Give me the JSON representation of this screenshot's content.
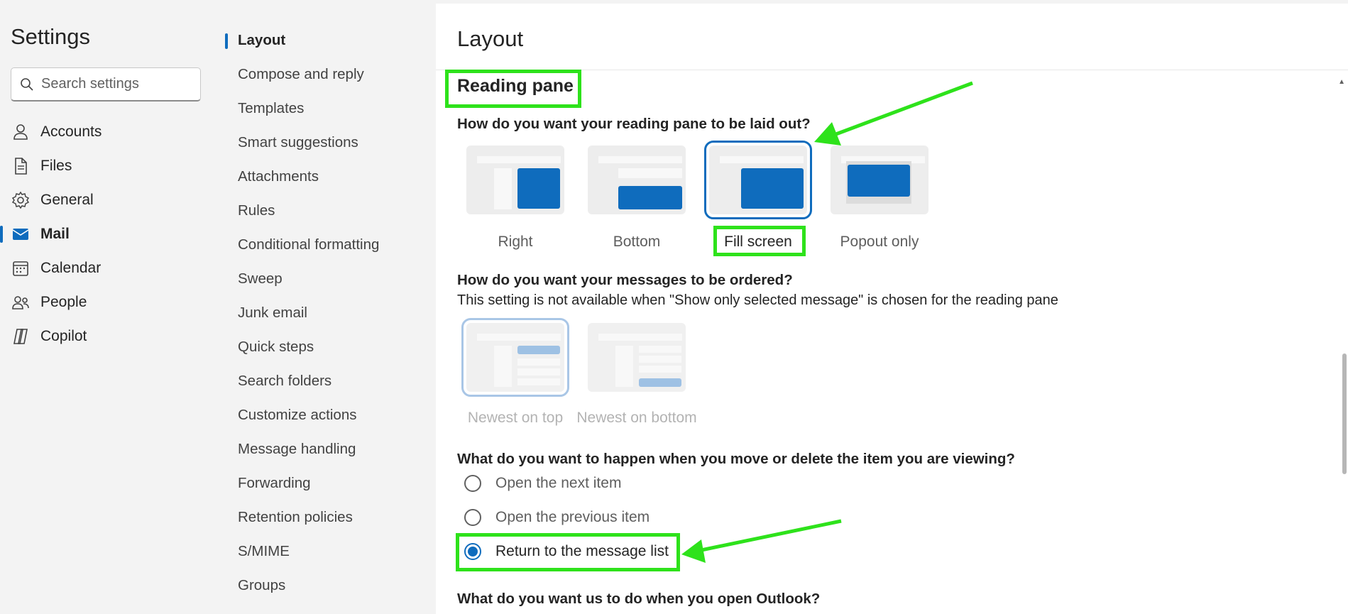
{
  "sidebar": {
    "title": "Settings",
    "search_placeholder": "Search settings",
    "items": [
      {
        "label": "Accounts",
        "icon": "person-icon"
      },
      {
        "label": "Files",
        "icon": "file-icon"
      },
      {
        "label": "General",
        "icon": "gear-icon"
      },
      {
        "label": "Mail",
        "icon": "mail-icon",
        "active": true
      },
      {
        "label": "Calendar",
        "icon": "calendar-icon"
      },
      {
        "label": "People",
        "icon": "people-icon"
      },
      {
        "label": "Copilot",
        "icon": "copilot-icon"
      }
    ]
  },
  "subnav": {
    "items": [
      "Layout",
      "Compose and reply",
      "Templates",
      "Smart suggestions",
      "Attachments",
      "Rules",
      "Conditional formatting",
      "Sweep",
      "Junk email",
      "Quick steps",
      "Search folders",
      "Customize actions",
      "Message handling",
      "Forwarding",
      "Retention policies",
      "S/MIME",
      "Groups"
    ],
    "active": "Layout"
  },
  "main": {
    "title": "Layout",
    "section_title": "Reading pane",
    "q1": "How do you want your reading pane to be laid out?",
    "pane_options": [
      "Right",
      "Bottom",
      "Fill screen",
      "Popout only"
    ],
    "pane_selected": "Fill screen",
    "q2": "How do you want your messages to be ordered?",
    "q2_note": "This setting is not available when \"Show only selected message\" is chosen for the reading pane",
    "order_options": [
      "Newest on top",
      "Newest on bottom"
    ],
    "q3": "What do you want to happen when you move or delete the item you are viewing?",
    "radio_options": [
      "Open the next item",
      "Open the previous item",
      "Return to the message list"
    ],
    "radio_selected": "Return to the message list",
    "q4": "What do you want us to do when you open Outlook?"
  },
  "colors": {
    "accent": "#0f6cbd",
    "annotation": "#2ee21b"
  }
}
